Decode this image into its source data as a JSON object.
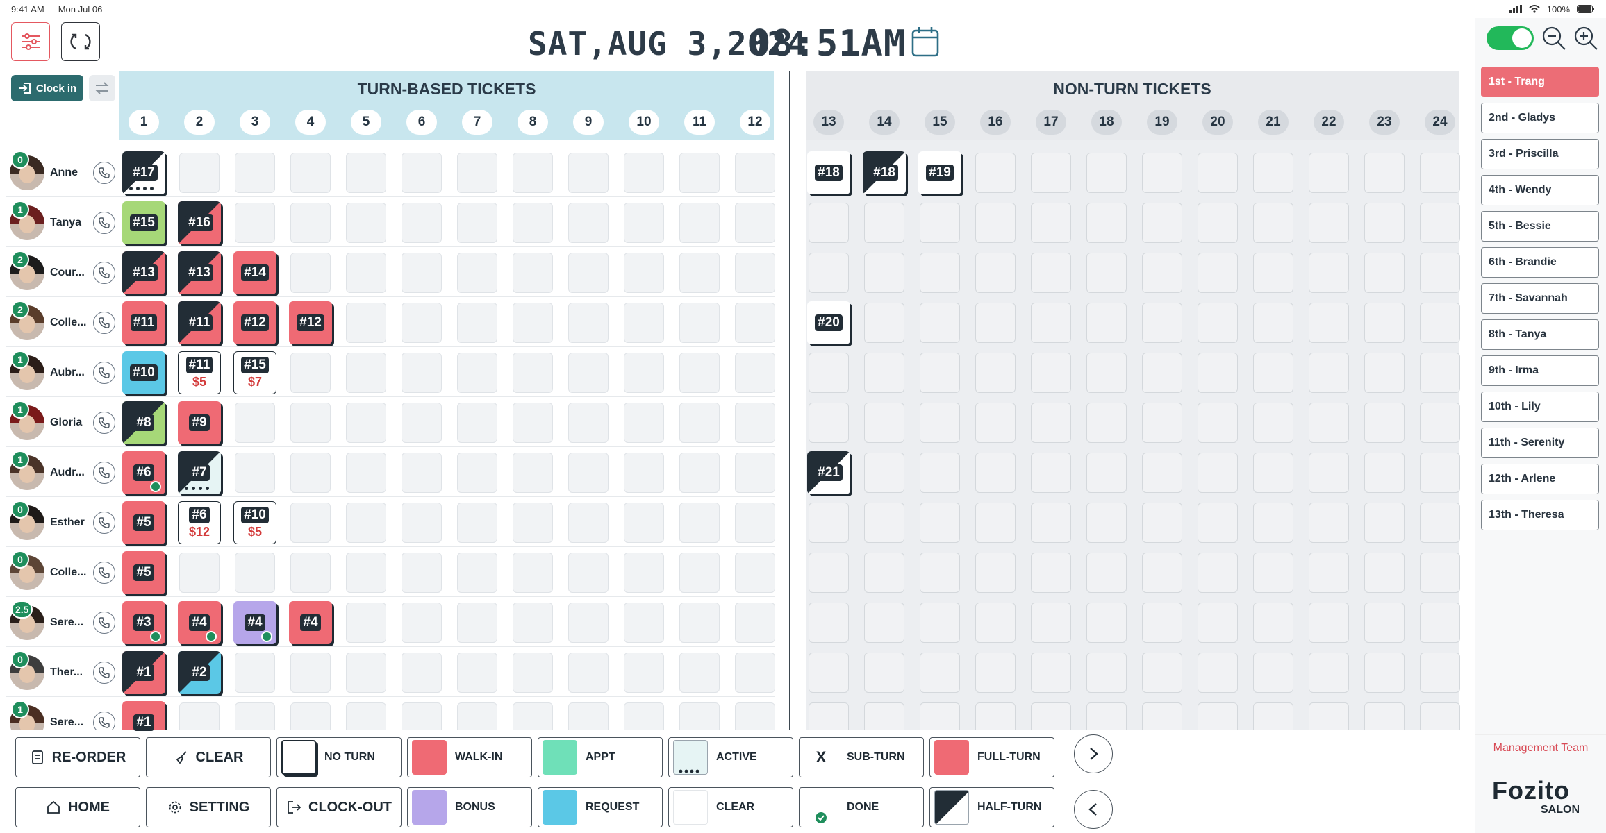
{
  "status_bar": {
    "time": "9:41 AM",
    "date": "Mon Jul 06",
    "battery": "100%"
  },
  "header": {
    "date": "SAT,AUG 3,2024",
    "time": "08:51AM"
  },
  "toolbar": {
    "clock_in_label": "Clock in"
  },
  "turn_section": {
    "title": "TURN-BASED TICKETS",
    "columns": [
      "1",
      "2",
      "3",
      "4",
      "5",
      "6",
      "7",
      "8",
      "9",
      "10",
      "11",
      "12"
    ]
  },
  "nonturn_section": {
    "title": "NON-TURN TICKETS",
    "columns": [
      "13",
      "14",
      "15",
      "16",
      "17",
      "18",
      "19",
      "20",
      "21",
      "22",
      "23",
      "24"
    ]
  },
  "employees": [
    {
      "name": "Anne",
      "turns": "0"
    },
    {
      "name": "Tanya",
      "turns": "1"
    },
    {
      "name": "Cour...",
      "turns": "2"
    },
    {
      "name": "Colle...",
      "turns": "2"
    },
    {
      "name": "Aubr...",
      "turns": "1"
    },
    {
      "name": "Gloria",
      "turns": "1"
    },
    {
      "name": "Audr...",
      "turns": "1"
    },
    {
      "name": "Esther",
      "turns": "0"
    },
    {
      "name": "Colle...",
      "turns": "0"
    },
    {
      "name": "Sere...",
      "turns": "2.5"
    },
    {
      "name": "Ther...",
      "turns": "0"
    },
    {
      "name": "Sere...",
      "turns": "1"
    }
  ],
  "tickets": [
    {
      "label": "#17",
      "row": 0,
      "col": 1,
      "type": "active",
      "color": "#ffffff"
    },
    {
      "label": "#18",
      "row": 0,
      "col": 13,
      "type": "clear",
      "color": "#ffffff"
    },
    {
      "label": "#18",
      "row": 0,
      "col": 14,
      "type": "half",
      "color": "#ffffff"
    },
    {
      "label": "#19",
      "row": 0,
      "col": 15,
      "type": "clear",
      "color": "#ffffff"
    },
    {
      "label": "#15",
      "row": 1,
      "col": 1,
      "type": "full",
      "color": "#a6d878"
    },
    {
      "label": "#16",
      "row": 1,
      "col": 2,
      "type": "half",
      "color": "#ef6a74"
    },
    {
      "label": "#13",
      "row": 2,
      "col": 1,
      "type": "half",
      "color": "#ef6a74"
    },
    {
      "label": "#13",
      "row": 2,
      "col": 2,
      "type": "half",
      "color": "#ef6a74"
    },
    {
      "label": "#14",
      "row": 2,
      "col": 3,
      "type": "full",
      "color": "#ef6a74"
    },
    {
      "label": "#11",
      "row": 3,
      "col": 1,
      "type": "full",
      "color": "#ef6a74"
    },
    {
      "label": "#11",
      "row": 3,
      "col": 2,
      "type": "half",
      "color": "#ef6a74"
    },
    {
      "label": "#12",
      "row": 3,
      "col": 3,
      "type": "full",
      "color": "#ef6a74"
    },
    {
      "label": "#12",
      "row": 3,
      "col": 4,
      "type": "full",
      "color": "#ef6a74"
    },
    {
      "label": "#20",
      "row": 3,
      "col": 13,
      "type": "clear",
      "color": "#ffffff"
    },
    {
      "label": "#10",
      "row": 4,
      "col": 1,
      "type": "full",
      "color": "#5bc8e6"
    },
    {
      "label": "#11",
      "row": 4,
      "col": 2,
      "type": "subturn",
      "color": "#ffffff",
      "amount": "$5"
    },
    {
      "label": "#15",
      "row": 4,
      "col": 3,
      "type": "subturn",
      "color": "#ffffff",
      "amount": "$7"
    },
    {
      "label": "#8",
      "row": 5,
      "col": 1,
      "type": "half",
      "color": "#a6d878"
    },
    {
      "label": "#9",
      "row": 5,
      "col": 2,
      "type": "full",
      "color": "#ef6a74"
    },
    {
      "label": "#6",
      "row": 6,
      "col": 1,
      "type": "done",
      "color": "#ef6a74"
    },
    {
      "label": "#7",
      "row": 6,
      "col": 2,
      "type": "active",
      "color": "#e6f4f4"
    },
    {
      "label": "#21",
      "row": 6,
      "col": 13,
      "type": "half",
      "color": "#ffffff"
    },
    {
      "label": "#5",
      "row": 7,
      "col": 1,
      "type": "full",
      "color": "#ef6a74"
    },
    {
      "label": "#6",
      "row": 7,
      "col": 2,
      "type": "subturn",
      "color": "#ffffff",
      "amount": "$12"
    },
    {
      "label": "#10",
      "row": 7,
      "col": 3,
      "type": "subturn",
      "color": "#ffffff",
      "amount": "$5"
    },
    {
      "label": "#5",
      "row": 8,
      "col": 1,
      "type": "full",
      "color": "#ef6a74"
    },
    {
      "label": "#3",
      "row": 9,
      "col": 1,
      "type": "done",
      "color": "#ef6a74"
    },
    {
      "label": "#4",
      "row": 9,
      "col": 2,
      "type": "done",
      "color": "#ef6a74"
    },
    {
      "label": "#4",
      "row": 9,
      "col": 3,
      "type": "done",
      "color": "#b6a6ea"
    },
    {
      "label": "#4",
      "row": 9,
      "col": 4,
      "type": "full",
      "color": "#ef6a74"
    },
    {
      "label": "#1",
      "row": 10,
      "col": 1,
      "type": "half",
      "color": "#ef6a74"
    },
    {
      "label": "#2",
      "row": 10,
      "col": 2,
      "type": "half",
      "color": "#5bc8e6"
    },
    {
      "label": "#1",
      "row": 11,
      "col": 1,
      "type": "full",
      "color": "#ef6a74"
    }
  ],
  "queue": [
    "1st - Trang",
    "2nd - Gladys",
    "3rd - Priscilla",
    "4th - Wendy",
    "5th - Bessie",
    "6th - Brandie",
    "7th - Savannah",
    "8th - Tanya",
    "9th - Irma",
    "10th - Lily",
    "11th - Serenity",
    "12th - Arlene",
    "13th - Theresa"
  ],
  "actions": {
    "reorder": "RE-ORDER",
    "clear": "CLEAR",
    "home": "HOME",
    "setting": "SETTING",
    "clock_out": "CLOCK-OUT"
  },
  "legend": [
    {
      "label": "NO TURN",
      "swatch": "noturn"
    },
    {
      "label": "WALK-IN",
      "swatch": "#ef6a74"
    },
    {
      "label": "APPT",
      "swatch": "#6fe0b8"
    },
    {
      "label": "ACTIVE",
      "swatch": "active"
    },
    {
      "label": "SUB-TURN",
      "swatch": "subturn",
      "mark": "X"
    },
    {
      "label": "FULL-TURN",
      "swatch": "#ef6a74"
    },
    {
      "label": "BONUS",
      "swatch": "#b6a6ea"
    },
    {
      "label": "REQUEST",
      "swatch": "#5bc8e6"
    },
    {
      "label": "CLEAR",
      "swatch": "clear"
    },
    {
      "label": "DONE",
      "swatch": "done"
    },
    {
      "label": "HALF-TURN",
      "swatch": "half"
    }
  ],
  "footer": {
    "team": "Management Team",
    "brand": "Fozito",
    "brand_sub": "SALON"
  }
}
